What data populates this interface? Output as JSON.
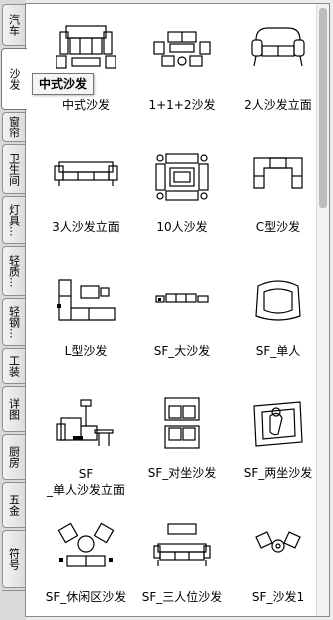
{
  "tabs": [
    {
      "label": "汽车",
      "active": false
    },
    {
      "label": "沙发",
      "active": true
    },
    {
      "label": "窗帘",
      "active": false
    },
    {
      "label": "卫生间",
      "active": false
    },
    {
      "label": "灯具...",
      "active": false
    },
    {
      "label": "轻质...",
      "active": false
    },
    {
      "label": "轻钢...",
      "active": false
    },
    {
      "label": "工装",
      "active": false
    },
    {
      "label": "详图",
      "active": false
    },
    {
      "label": "厨房",
      "active": false
    },
    {
      "label": "五金",
      "active": false
    },
    {
      "label": "符号",
      "active": false
    }
  ],
  "tooltip": {
    "text": "中式沙发"
  },
  "items": [
    {
      "label": "中式沙发",
      "icon": "chinese-sofa-plan-icon"
    },
    {
      "label": "1+1+2沙发",
      "icon": "sofa-set-112-icon"
    },
    {
      "label": "2人沙发立面",
      "icon": "two-seat-sofa-elevation-icon"
    },
    {
      "label": "3人沙发立面",
      "icon": "three-seat-sofa-elevation-icon"
    },
    {
      "label": "10人沙发",
      "icon": "ten-person-sofa-icon"
    },
    {
      "label": "C型沙发",
      "icon": "c-shaped-sofa-icon"
    },
    {
      "label": "L型沙发",
      "icon": "l-shaped-sofa-icon"
    },
    {
      "label": "SF_大沙发",
      "icon": "large-sofa-icon"
    },
    {
      "label": "SF_单人",
      "icon": "single-sofa-icon"
    },
    {
      "label": "SF\n_单人沙发立面",
      "icon": "single-sofa-elevation-icon"
    },
    {
      "label": "SF_对坐沙发",
      "icon": "facing-sofas-icon"
    },
    {
      "label": "SF_两坐沙发",
      "icon": "two-seat-sofa-icon"
    },
    {
      "label": "SF_休闲区沙发",
      "icon": "lounge-area-sofa-icon"
    },
    {
      "label": "SF_三人位沙发",
      "icon": "three-seat-sofa-icon"
    },
    {
      "label": "SF_沙发1",
      "icon": "sofa-1-icon"
    }
  ]
}
